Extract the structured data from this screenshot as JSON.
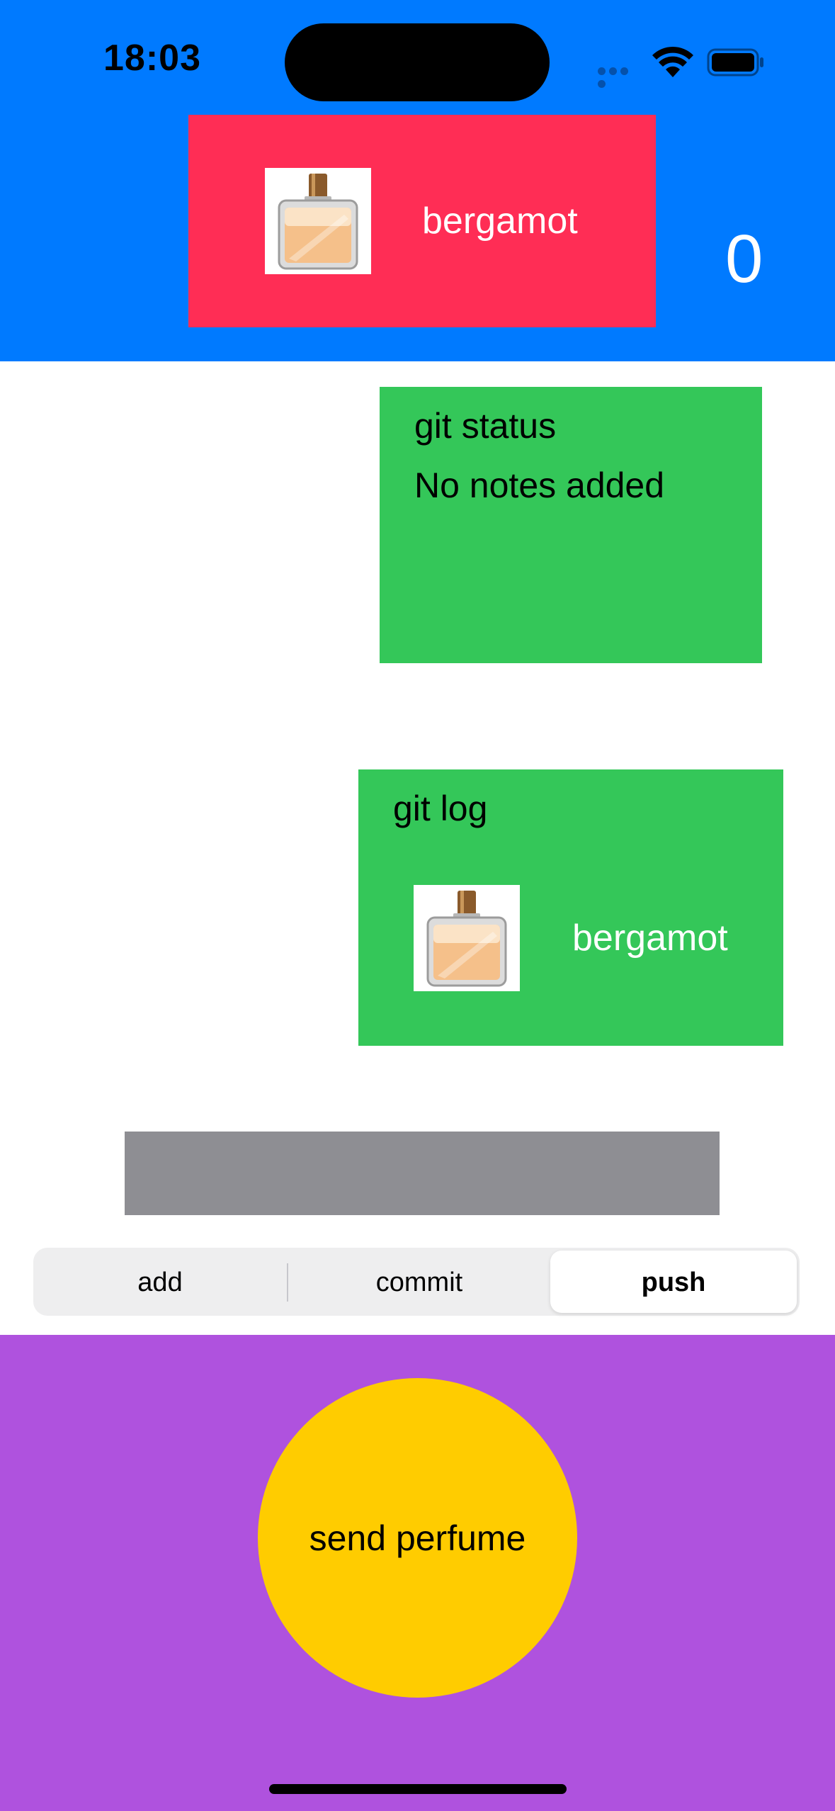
{
  "status_bar": {
    "time": "18:03"
  },
  "header": {
    "bg_color": "#007aff",
    "card_color": "#ff2d55",
    "note_image": "perfume-bottle-image",
    "note_label": "bergamot",
    "counter": "0"
  },
  "git_status": {
    "title": "git status",
    "message": "No notes added",
    "bg_color": "#34c759"
  },
  "git_log": {
    "title": "git log",
    "entries": [
      {
        "image": "perfume-bottle-image",
        "label": "bergamot"
      }
    ],
    "bg_color": "#34c759"
  },
  "gray_bar_color": "#8e8e93",
  "segmented": {
    "options": [
      "add",
      "commit",
      "push"
    ],
    "selected": "push"
  },
  "bottom": {
    "bg_color": "#af52de",
    "button_color": "#ffcc00",
    "send_label": "send perfume"
  }
}
